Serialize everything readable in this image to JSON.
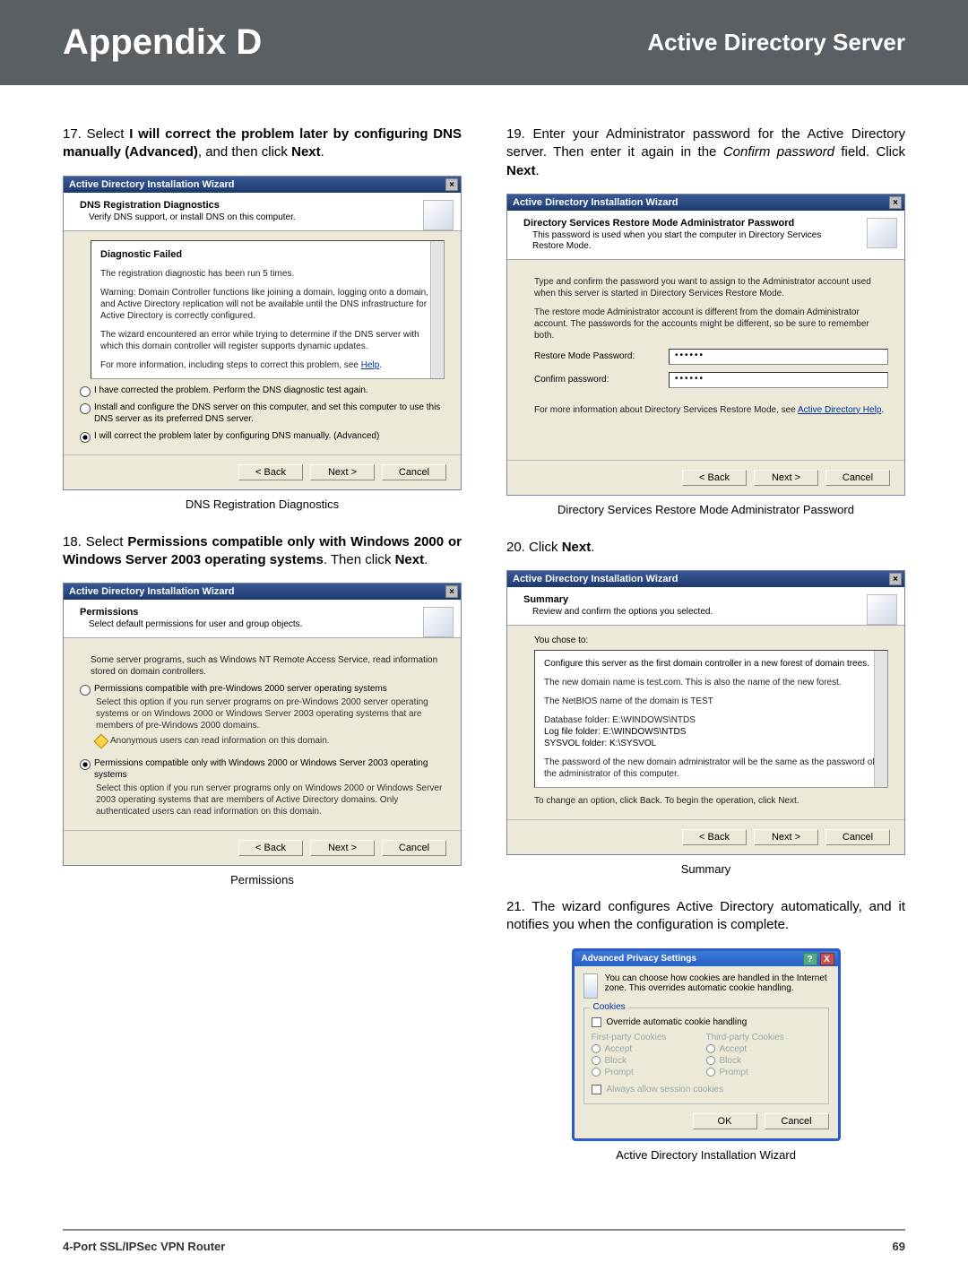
{
  "header": {
    "title": "Appendix D",
    "subtitle": "Active Directory Server"
  },
  "footer": {
    "product": "4-Port SSL/IPSec VPN Router",
    "page": "69"
  },
  "steps": {
    "s17a": "17. Select ",
    "s17b": "I will correct the problem later by configuring DNS manually (Advanced)",
    "s17c": ", and then click ",
    "s17d": "Next",
    "s17e": ".",
    "s18a": "18. Select ",
    "s18b": "Permissions compatible only with Windows 2000 or Windows Server 2003 operating systems",
    "s18c": ". Then click ",
    "s18d": "Next",
    "s18e": ".",
    "s19a": "19. Enter your Administrator password for the Active Directory server. Then enter it again in the ",
    "s19b": "Confirm password",
    "s19c": " field. Click ",
    "s19d": "Next",
    "s19e": ".",
    "s20a": "20. Click ",
    "s20b": "Next",
    "s20c": ".",
    "s21": "21. The wizard configures Active Directory automatically, and it notifies you when the configuration is complete."
  },
  "captions": {
    "c1": "DNS Registration Diagnostics",
    "c2": "Permissions",
    "c3": "Directory Services Restore Mode Administrator Password",
    "c4": "Summary",
    "c5": "Active Directory Installation Wizard"
  },
  "wiz_common": {
    "title": "Active Directory Installation Wizard",
    "back": "< Back",
    "next": "Next >",
    "cancel": "Cancel"
  },
  "wiz1": {
    "head_title": "DNS Registration Diagnostics",
    "head_sub": "Verify DNS support, or install DNS on this computer.",
    "diag_failed": "Diagnostic Failed",
    "l1": "The registration diagnostic has been run 5 times.",
    "l2": "Warning: Domain Controller functions like joining a domain, logging onto a domain, and Active Directory replication will not be available until the DNS infrastructure for Active Directory is correctly configured.",
    "l3": "The wizard encountered an error while trying to determine if the DNS server with which this domain controller will register supports dynamic updates.",
    "l4a": "For more information, including steps to correct this problem, see ",
    "l4b": "Help",
    "r1": "I have corrected the problem. Perform the DNS diagnostic test again.",
    "r2": "Install and configure the DNS server on this computer, and set this computer to use this DNS server as its preferred DNS server.",
    "r3": "I will correct the problem later by configuring DNS manually. (Advanced)"
  },
  "wiz2": {
    "head_title": "Permissions",
    "head_sub": "Select default permissions for user and group objects.",
    "intro": "Some server programs, such as Windows NT Remote Access Service, read information stored on domain controllers.",
    "r1": "Permissions compatible with pre-Windows 2000 server operating systems",
    "r1s": "Select this option if you run server programs on pre-Windows 2000 server operating systems or on Windows 2000 or Windows Server 2003 operating systems that are members of pre-Windows 2000 domains.",
    "r1w": "Anonymous users can read information on this domain.",
    "r2": "Permissions compatible only with Windows 2000 or Windows Server 2003 operating systems",
    "r2s": "Select this option if you run server programs only on Windows 2000 or Windows Server 2003 operating systems that are members of Active Directory domains. Only authenticated users can read information on this domain."
  },
  "wiz3": {
    "head_title": "Directory Services Restore Mode Administrator Password",
    "head_sub": "This password is used when you start the computer in Directory Services Restore Mode.",
    "p1": "Type and confirm the password you want to assign to the Administrator account used when this server is started in Directory Services Restore Mode.",
    "p2": "The restore mode Administrator account is different from the domain Administrator account. The passwords for the accounts might be different, so be sure to remember both.",
    "lbl1": "Restore Mode Password:",
    "lbl2": "Confirm password:",
    "pw": "••••••",
    "foot_a": "For more information about Directory Services Restore Mode, see ",
    "foot_b": "Active Directory Help"
  },
  "wiz4": {
    "head_title": "Summary",
    "head_sub": "Review and confirm the options you selected.",
    "l0": "You chose to:",
    "l1": "Configure this server as the first domain controller in a new forest of domain trees.",
    "l2": "The new domain name is test.com. This is also the name of the new forest.",
    "l3": "The NetBIOS name of the domain is TEST",
    "l4": "Database folder: E:\\WINDOWS\\NTDS",
    "l5": "Log file folder: E:\\WINDOWS\\NTDS",
    "l6": "SYSVOL folder: K:\\SYSVOL",
    "l7": "The password of the new domain administrator will be the same as the password of the administrator of this computer.",
    "foot": "To change an option, click Back. To begin the operation, click Next."
  },
  "aps": {
    "title": "Advanced Privacy Settings",
    "intro": "You can choose how cookies are handled in the Internet zone. This overrides automatic cookie handling.",
    "group": "Cookies",
    "chk1": "Override automatic cookie handling",
    "hdr1": "First-party Cookies",
    "hdr2": "Third-party Cookies",
    "accept": "Accept",
    "block": "Block",
    "prompt": "Prompt",
    "chk2": "Always allow session cookies",
    "ok": "OK",
    "cancel": "Cancel"
  }
}
